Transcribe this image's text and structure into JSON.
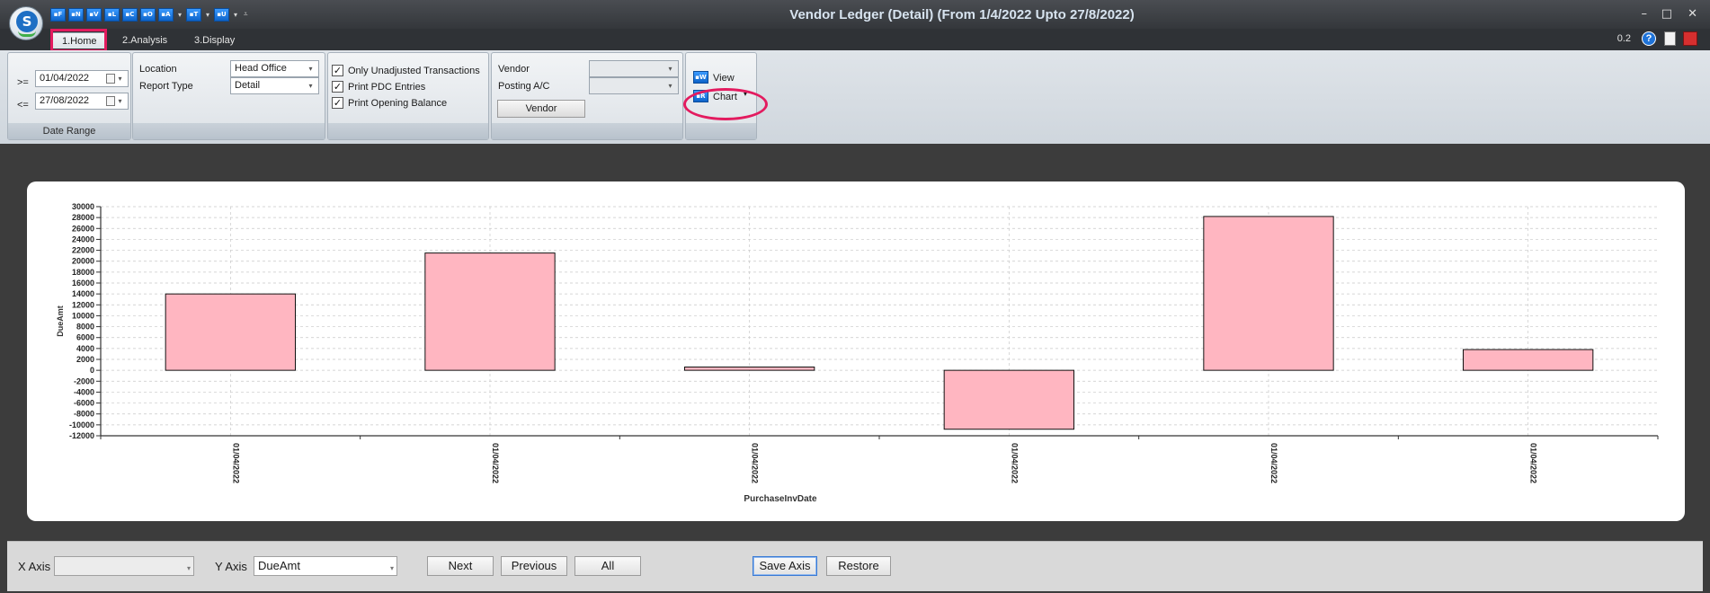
{
  "window": {
    "title": "Vendor Ledger (Detail)  (From 1/4/2022 Upto 27/8/2022)",
    "version": "0.2",
    "minimize": "–",
    "maximize": "□",
    "close": "✕"
  },
  "app": {
    "orb_letter": "S"
  },
  "quick_access": [
    {
      "label": "▪F"
    },
    {
      "label": "▪N"
    },
    {
      "label": "▪V"
    },
    {
      "label": "▪L"
    },
    {
      "label": "▪C"
    },
    {
      "label": "▪O"
    },
    {
      "label": "▪A"
    },
    {
      "label": "▪T"
    },
    {
      "label": "▪U"
    }
  ],
  "tabs": [
    {
      "label": "1.Home"
    },
    {
      "label": "2.Analysis"
    },
    {
      "label": "3.Display"
    }
  ],
  "ribbon": {
    "date_range": {
      "caption": "Date Range",
      "from_op": ">=",
      "from_value": "01/04/2022",
      "to_op": "<=",
      "to_value": "27/08/2022"
    },
    "location": {
      "location_label": "Location",
      "location_value": "Head Office",
      "report_type_label": "Report Type",
      "report_type_value": "Detail"
    },
    "options": {
      "only_unadjusted": "Only Unadjusted Transactions",
      "print_pdc": "Print PDC Entries",
      "print_opening": "Print Opening Balance",
      "check_mark": "✓"
    },
    "vendor": {
      "vendor_label": "Vendor",
      "vendor_value": "",
      "posting_label": "Posting A/C",
      "posting_value": "",
      "vendor_button": "Vendor"
    },
    "view": {
      "view_label": "View",
      "chart_label": "Chart"
    }
  },
  "chart_data": {
    "type": "bar",
    "xlabel": "PurchaseInvDate",
    "ylabel": "DueAmt",
    "ylim": [
      -12000,
      30000
    ],
    "ytick_step": 2000,
    "grid": true,
    "bar_color": "#ffb6c1",
    "categories": [
      "01/04/2022",
      "01/04/2022",
      "01/04/2022",
      "01/04/2022",
      "01/04/2022",
      "01/04/2022"
    ],
    "values": [
      14000,
      21500,
      600,
      -10800,
      28200,
      3800
    ]
  },
  "bottom": {
    "x_axis_label": "X Axis",
    "x_axis_value": "",
    "y_axis_label": "Y Axis",
    "y_axis_value": "DueAmt",
    "next": "Next",
    "previous": "Previous",
    "all": "All",
    "save_axis": "Save Axis",
    "restore": "Restore"
  }
}
